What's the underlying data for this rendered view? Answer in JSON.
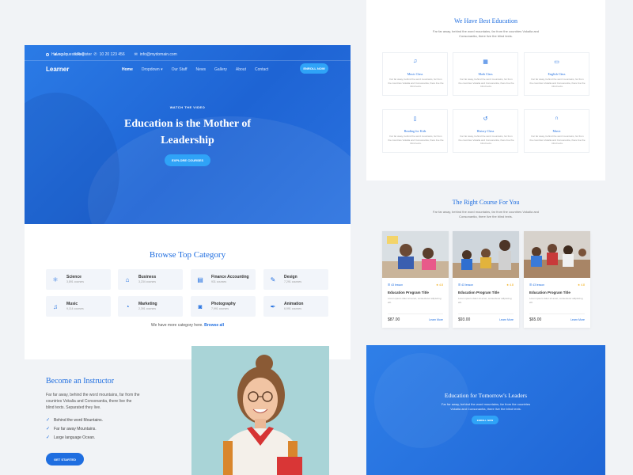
{
  "topbar": {
    "question": "Have a questions?",
    "phone": "10 20 123 456",
    "email": "info@mydomain.com",
    "login": "Log In",
    "register": "Register"
  },
  "brand": {
    "name": "Learner"
  },
  "nav": {
    "items": [
      "Home",
      "Dropdown",
      "Our Staff",
      "News",
      "Gallery",
      "About",
      "Contact"
    ],
    "active": "Home",
    "enroll_label": "ENROLL NOW"
  },
  "hero": {
    "eyebrow": "WATCH THE VIDEO",
    "title_line1": "Education is the Mother of",
    "title_line2": "Leadership",
    "cta": "EXPLORE COURSES"
  },
  "browse": {
    "title": "Browse Top Category",
    "categories": [
      {
        "name": "Science",
        "count": "3,891 courses",
        "icon": "atom-icon"
      },
      {
        "name": "Business",
        "count": "3,234 courses",
        "icon": "briefcase-icon"
      },
      {
        "name": "Finance Accounting",
        "count": "931 courses",
        "icon": "calculator-icon"
      },
      {
        "name": "Design",
        "count": "7,291 courses",
        "icon": "pencil-icon"
      },
      {
        "name": "Music",
        "count": "9,114 courses",
        "icon": "music-icon"
      },
      {
        "name": "Marketing",
        "count": "2,391 courses",
        "icon": "chart-pie-icon"
      },
      {
        "name": "Photography",
        "count": "7,991 courses",
        "icon": "camera-icon"
      },
      {
        "name": "Animation",
        "count": "6,991 courses",
        "icon": "pen-tool-icon"
      }
    ],
    "more_text": "We have more category here.",
    "more_link": "Browse all"
  },
  "instructor": {
    "title": "Become an Instructor",
    "text": "Far far away, behind the word mountains, far from the countries Vokalia and Consonantia, there live the blind texts. Separated they live.",
    "list": [
      "Behind the word Mountains.",
      "Far far away Mountains.",
      "Large language Ocean."
    ],
    "cta": "GET STARTED"
  },
  "best": {
    "title": "We Have Best Education",
    "subtitle_line1": "Far far away, behind the word mountains, far from the countries Vokalia and",
    "subtitle_line2": "Consonantia, there live the blind texts.",
    "cards": [
      {
        "name": "Music Class",
        "icon": "music-note-icon",
        "text": "Far far away, behind the word mountains, far from the countries Vokalia and Consonantia, there live the blind texts."
      },
      {
        "name": "Math Class",
        "icon": "calculator-icon",
        "text": "Far far away, behind the word mountains, far from the countries Vokalia and Consonantia, there live the blind texts."
      },
      {
        "name": "English Class",
        "icon": "monitor-icon",
        "text": "Far far away, behind the word mountains, far from the countries Vokalia and Consonantia, there live the blind texts."
      },
      {
        "name": "Reading for Kids",
        "icon": "book-icon",
        "text": "Far far away, behind the word mountains, far from the countries Vokalia and Consonantia, there live the blind texts."
      },
      {
        "name": "History Class",
        "icon": "history-icon",
        "text": "Far far away, behind the word mountains, far from the countries Vokalia and Consonantia, there live the blind texts."
      },
      {
        "name": "Music",
        "icon": "headphones-icon",
        "text": "Far far away, behind the word mountains, far from the countries Vokalia and Consonantia, there live the blind texts."
      }
    ]
  },
  "courses": {
    "title": "The Right Course For You",
    "subtitle_line1": "Far far away, behind the word mountains, far from the countries Vokalia and",
    "subtitle_line2": "Consonantia, there live the blind texts.",
    "items": [
      {
        "lessons": "43 lesson",
        "rating": "4.8",
        "title": "Education Program Title",
        "text": "Lorem ipsum dolor sit amet, consectetur adipiscing elit.",
        "price": "$87.00",
        "link": "Learn More"
      },
      {
        "lessons": "43 lesson",
        "rating": "4.8",
        "title": "Education Program Title",
        "text": "Lorem ipsum dolor sit amet, consectetur adipiscing elit.",
        "price": "$93.00",
        "link": "Learn More"
      },
      {
        "lessons": "43 lesson",
        "rating": "4.8",
        "title": "Education Program Title",
        "text": "Lorem ipsum dolor sit amet, consectetur adipiscing elit.",
        "price": "$65.00",
        "link": "Learn More"
      }
    ]
  },
  "cta": {
    "title": "Education for Tomorrow's Leaders",
    "subtitle_line1": "Far far away, behind the word mountains, far from the countries",
    "subtitle_line2": "Vokalia and Consonantia, there live the blind texts.",
    "button": "ENROLL NOW"
  },
  "colors": {
    "primary": "#1f6ee0",
    "accent": "#2fa3f7",
    "background": "#f1f3f6"
  }
}
